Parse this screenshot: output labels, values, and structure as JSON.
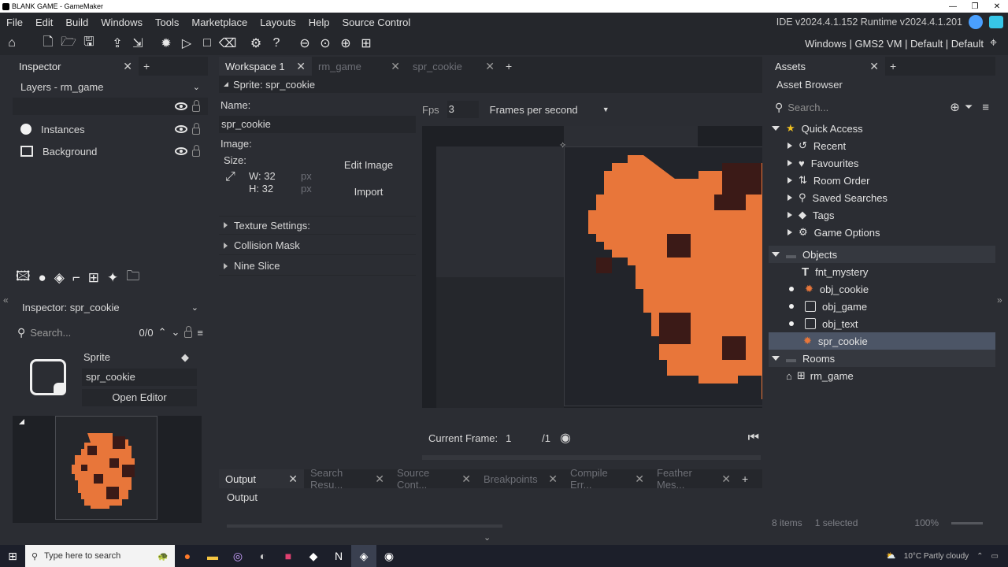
{
  "window": {
    "title": "BLANK GAME - GameMaker"
  },
  "menu": {
    "items": [
      "File",
      "Edit",
      "Build",
      "Windows",
      "Tools",
      "Marketplace",
      "Layouts",
      "Help",
      "Source Control"
    ],
    "version": "IDE v2024.4.1.152  Runtime v2024.4.1.201"
  },
  "toolbar": {
    "target": "Windows | GMS2 VM | Default | Default"
  },
  "inspector": {
    "tab": "Inspector",
    "layers_title": "Layers - rm_game",
    "layers": [
      "Instances",
      "Background"
    ],
    "sub_title": "Inspector: spr_cookie",
    "search_placeholder": "Search...",
    "search_count": "0/0",
    "sprite_label": "Sprite",
    "sprite_name": "spr_cookie",
    "open_editor": "Open Editor"
  },
  "workspace": {
    "tabs": [
      {
        "label": "Workspace 1",
        "active": true
      },
      {
        "label": "rm_game",
        "active": false
      },
      {
        "label": "spr_cookie",
        "active": false
      }
    ],
    "sprite_header": "Sprite: spr_cookie",
    "name_label": "Name:",
    "name_value": "spr_cookie",
    "image_label": "Image:",
    "size_label": "Size:",
    "width": "W: 32",
    "height": "H: 32",
    "unit": "px",
    "edit_image": "Edit Image",
    "import": "Import",
    "sections": [
      "Texture Settings:",
      "Collision Mask",
      "Nine Slice"
    ],
    "fps_label": "Fps",
    "fps_value": "3",
    "fps_mode": "Frames per second",
    "current_frame_label": "Current Frame:",
    "current_frame": "1",
    "total_frames": "/1"
  },
  "output": {
    "tabs": [
      "Output",
      "Search Resu...",
      "Source Cont...",
      "Breakpoints",
      "Compile Err...",
      "Feather Mes..."
    ],
    "title": "Output"
  },
  "assets": {
    "tab": "Assets",
    "browser_title": "Asset Browser",
    "search_placeholder": "Search...",
    "quick_access": "Quick Access",
    "quick_items": [
      "Recent",
      "Favourites",
      "Room Order",
      "Saved Searches",
      "Tags",
      "Game Options"
    ],
    "objects_folder": "Objects",
    "objects": [
      "fnt_mystery",
      "obj_cookie",
      "obj_game",
      "obj_text",
      "spr_cookie"
    ],
    "rooms_folder": "Rooms",
    "rooms": [
      "rm_game"
    ],
    "status_items": "8 items",
    "status_selected": "1 selected",
    "status_zoom": "100%"
  },
  "taskbar": {
    "search_placeholder": "Type here to search",
    "weather": "10°C  Partly cloudy"
  },
  "colors": {
    "accent": "#4aa0ff",
    "cookie": "#e8763a",
    "cookie_chip": "#3b1a17",
    "selected_row": "#4c5566"
  }
}
